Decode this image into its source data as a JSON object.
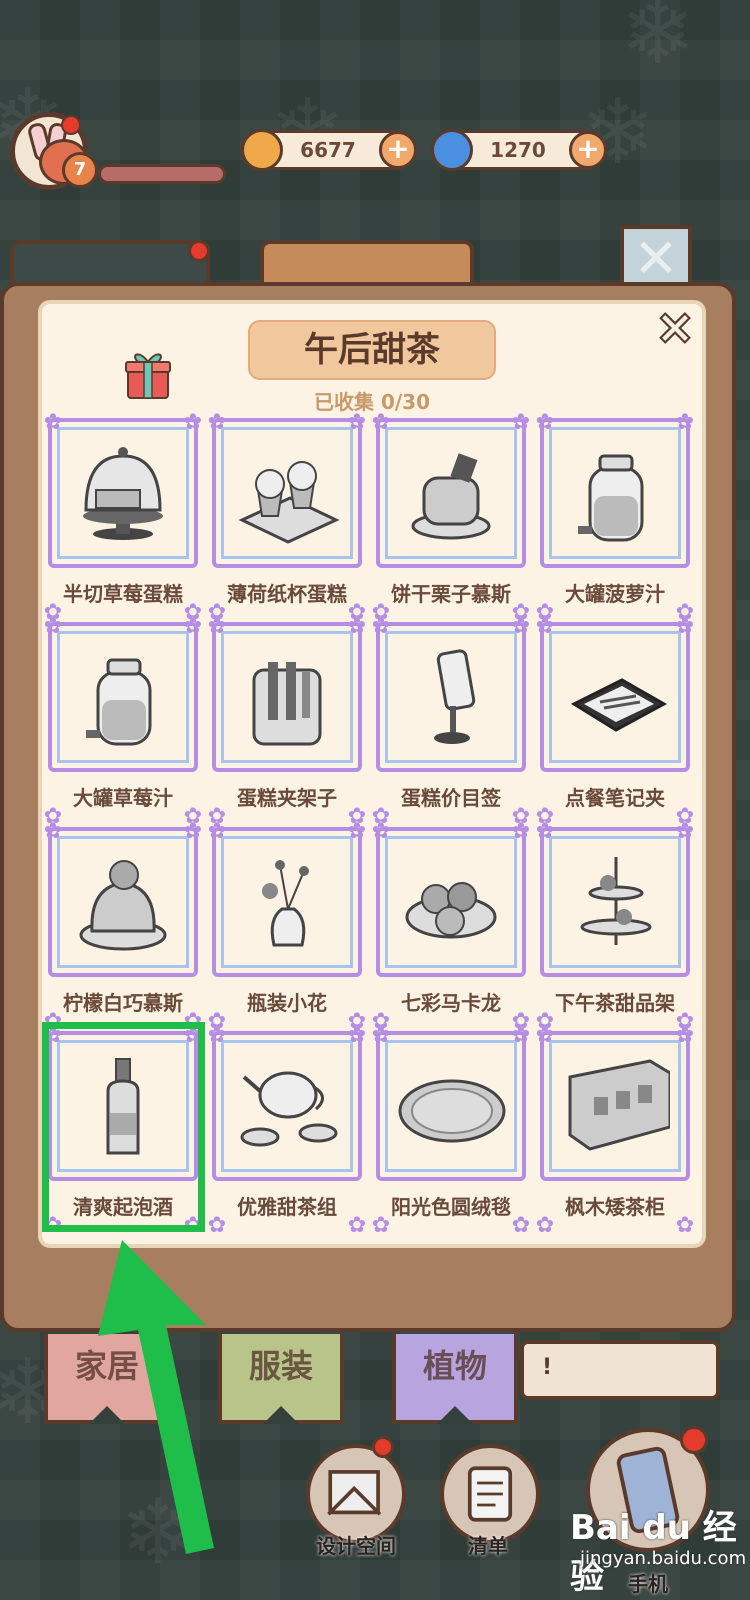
{
  "hud": {
    "level": "7",
    "coins": "6677",
    "gems": "1270",
    "plus_label": "+"
  },
  "panel": {
    "title": "午后甜茶",
    "progress": "已收集 0/30",
    "close_label": "✕"
  },
  "items": [
    {
      "name": "半切草莓蛋糕",
      "icon": "cake-dome-icon"
    },
    {
      "name": "薄荷纸杯蛋糕",
      "icon": "cupcake-tray-icon"
    },
    {
      "name": "饼干栗子慕斯",
      "icon": "mousse-cake-icon"
    },
    {
      "name": "大罐菠萝汁",
      "icon": "juice-jar-icon"
    },
    {
      "name": "大罐草莓汁",
      "icon": "juice-jar-icon"
    },
    {
      "name": "蛋糕夹架子",
      "icon": "tong-rack-icon"
    },
    {
      "name": "蛋糕价目签",
      "icon": "price-sign-icon"
    },
    {
      "name": "点餐笔记夹",
      "icon": "clipboard-icon"
    },
    {
      "name": "柠檬白巧慕斯",
      "icon": "pudding-icon"
    },
    {
      "name": "瓶装小花",
      "icon": "flower-vase-icon"
    },
    {
      "name": "七彩马卡龙",
      "icon": "macaron-icon"
    },
    {
      "name": "下午茶甜品架",
      "icon": "dessert-stand-icon"
    },
    {
      "name": "清爽起泡酒",
      "icon": "wine-bottle-icon"
    },
    {
      "name": "优雅甜茶组",
      "icon": "tea-set-icon"
    },
    {
      "name": "阳光色圆绒毯",
      "icon": "round-rug-icon"
    },
    {
      "name": "枫木矮茶柜",
      "icon": "tea-cabinet-icon"
    }
  ],
  "bottom_tabs": [
    "家居",
    "服装",
    "植物"
  ],
  "bubble_text": "!",
  "bottom_buttons": [
    {
      "label": "设计空间"
    },
    {
      "label": "清单"
    },
    {
      "label": "手机"
    }
  ],
  "watermark": {
    "brand": "Bai du 经验",
    "url": "jingyan.baidu.com"
  },
  "colors": {
    "highlight": "#1fbe4a",
    "arrow": "#1fbe4a",
    "frame": "#b58ee4"
  }
}
